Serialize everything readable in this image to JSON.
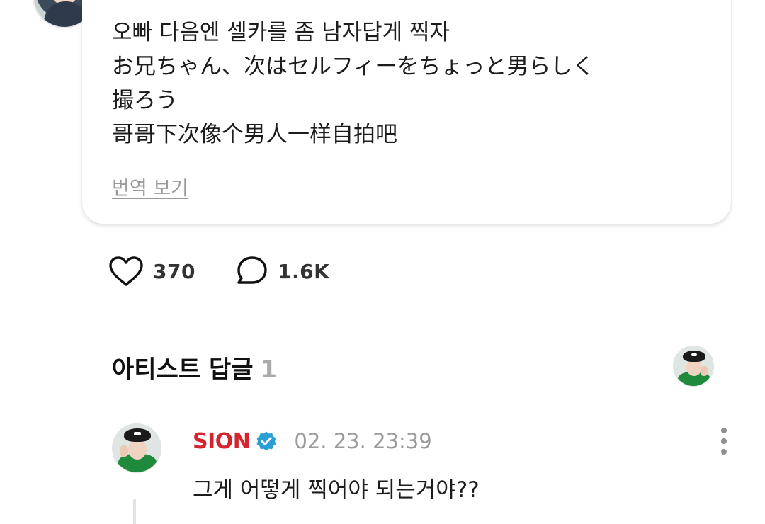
{
  "comment": {
    "lines": [
      "오빠 다음엔 셀카를 좀 남자답게 찍자",
      "お兄ちゃん、次はセルフィーをちょっと男らしく",
      "撮ろう",
      "哥哥下次像个男人一样自拍吧"
    ],
    "translate_link": "번역 보기"
  },
  "actions": {
    "likes": "370",
    "comments": "1.6K",
    "icons": {
      "like": "heart-outline-icon",
      "comment": "speech-bubble-icon"
    }
  },
  "artist_replies": {
    "title": "아티스트 답글",
    "count": "1"
  },
  "reply": {
    "name": "SION",
    "timestamp": "02. 23. 23:39",
    "text": "그게 어떻게 찍어야 되는거야??",
    "colors": {
      "name": "#d4252f",
      "verified": "#2a9fd6"
    }
  }
}
